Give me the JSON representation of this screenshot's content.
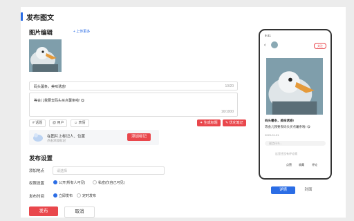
{
  "header": {
    "title": "发布图文"
  },
  "image_section": {
    "title": "图片编辑",
    "upload_more": "+ 上传更多"
  },
  "title_input": {
    "value": "码头薯条，美味诱惑!",
    "count": "10/20"
  },
  "content_input": {
    "value": "等会儿我要去码头买点薯条啦! 😋",
    "count": "16/1000"
  },
  "toolbar": {
    "topic": "# 话题",
    "user": "@ 用户",
    "emoji": "☺ 表情",
    "gen_title": "✦ 生成标题",
    "optimize": "✎ 优化笔记"
  },
  "tag": {
    "line1": "在图片上标记人、位置",
    "line2": "点击添加标记",
    "button": "添加标记"
  },
  "settings": {
    "title": "发布设置",
    "location_label": "添加地点",
    "location_placeholder": "请选择",
    "permission_label": "权限设置",
    "perm_public": "公开(所有人可见)",
    "perm_private": "私密(仅自己可见)",
    "time_label": "发布时间",
    "time_now": "立即发布",
    "time_scheduled": "定时发布"
  },
  "actions": {
    "publish": "发布",
    "cancel": "取消"
  },
  "preview": {
    "clock": "9:41",
    "follow": "关注",
    "post_title": "码头薯条，美味诱惑!",
    "post_body": "等会儿我要去码头买点薯条啦! 😋",
    "date": "2023-01-01",
    "comment_placeholder": "说点什么...",
    "no_comments": "这里还没有评论哦",
    "like": "点赞",
    "collect": "收藏",
    "comment": "评论",
    "tab_detail": "详情",
    "tab_cover": "封面"
  },
  "colors": {
    "accent": "#e9474c",
    "primary": "#2b6de5"
  }
}
